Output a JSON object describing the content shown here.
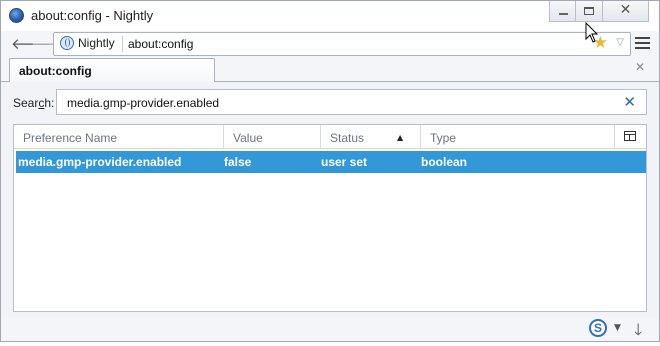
{
  "window": {
    "title": "about:config - Nightly",
    "icon": "nightly-globe-icon"
  },
  "controls": {
    "minimize": "minimize-icon",
    "maximize": "maximize-icon",
    "close": "✕"
  },
  "nav": {
    "back": "🡐",
    "forward": "🡒",
    "identity_label": "Nightly",
    "url": "about:config",
    "bookmark_star": "★",
    "dropmarker": "▽"
  },
  "tabs": [
    {
      "label": "about:config",
      "active": true
    }
  ],
  "tab_close": "✕",
  "search": {
    "label_prefix": "Sear",
    "label_accesskey": "c",
    "label_suffix": "h:",
    "value": "media.gmp-provider.enabled",
    "clear": "✕"
  },
  "table": {
    "columns": [
      "Preference Name",
      "Value",
      "Status",
      "Type"
    ],
    "sort_indicator": "▲",
    "rows": [
      {
        "name": "media.gmp-provider.enabled",
        "value": "false",
        "status": "user set",
        "type": "boolean",
        "selected": true
      }
    ]
  },
  "bottom": {
    "addon_letter": "S",
    "addon_drop": "▼",
    "download": "🡓"
  },
  "colors": {
    "selection": "#3298d8",
    "accent": "#2f6fc0"
  }
}
